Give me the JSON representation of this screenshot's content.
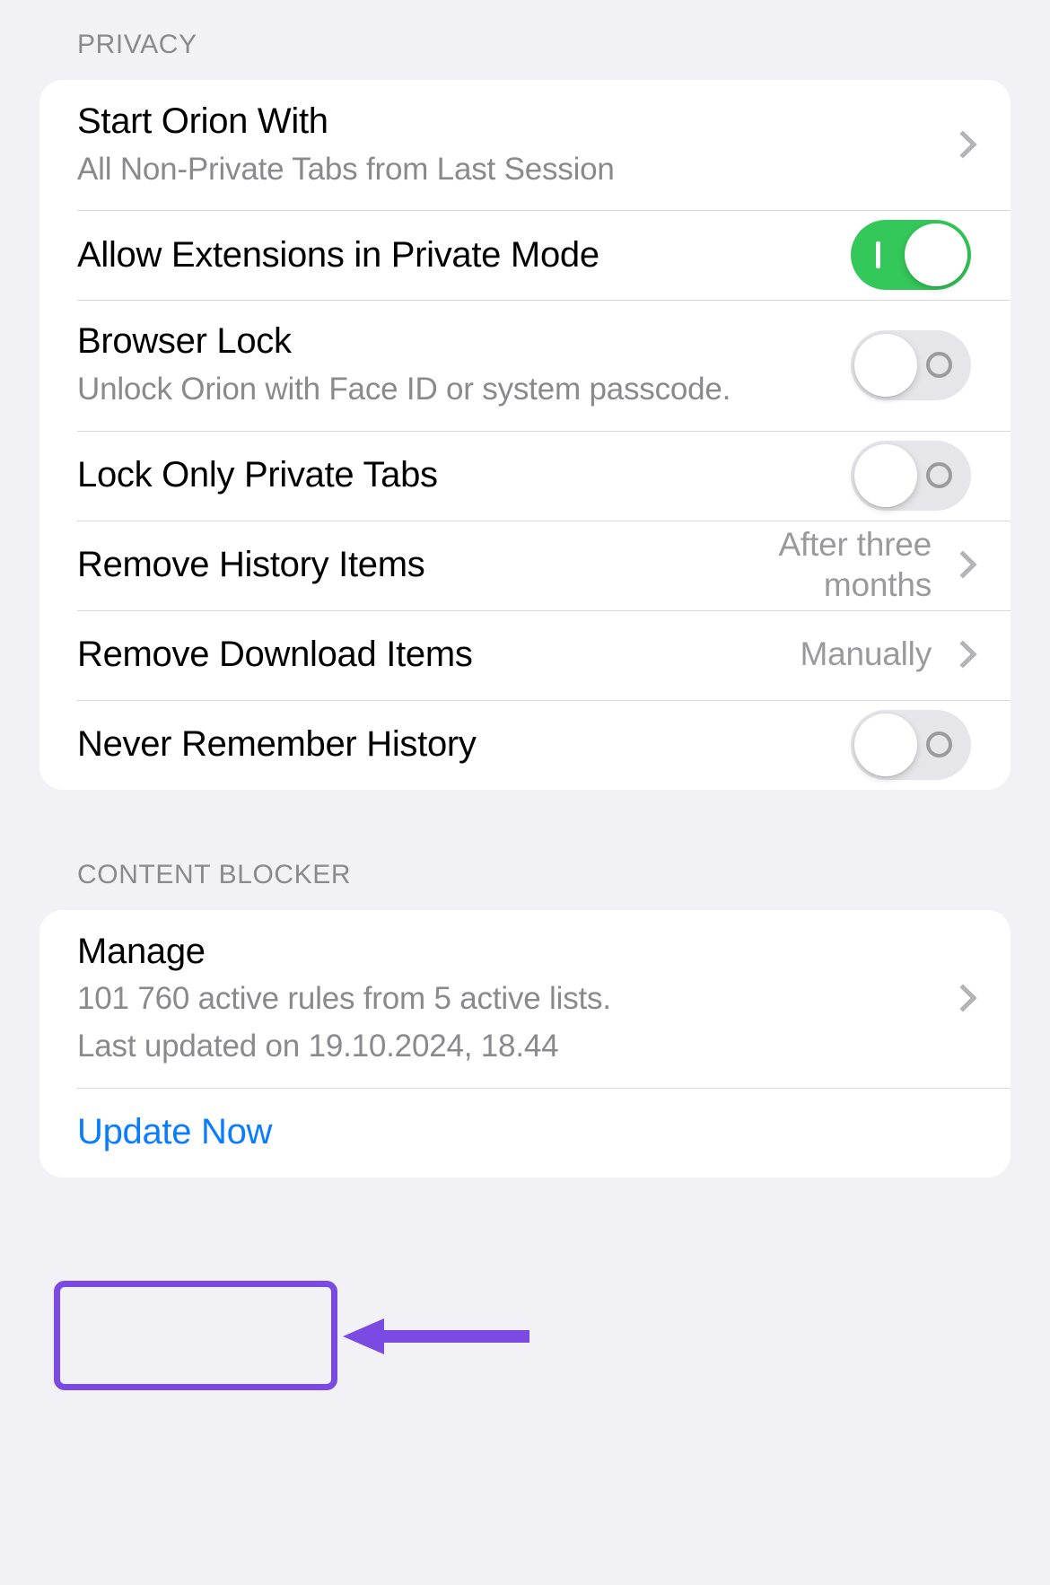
{
  "sections": [
    {
      "header": "PRIVACY",
      "rows": [
        {
          "name": "start-orion-with",
          "title": "Start Orion With",
          "subtitle": "All Non-Private Tabs from Last Session",
          "accessory": "chevron"
        },
        {
          "name": "allow-extensions-in-private-mode",
          "title": "Allow Extensions in Private Mode",
          "accessory": "toggle",
          "toggle_state": "on"
        },
        {
          "name": "browser-lock",
          "title": "Browser Lock",
          "subtitle": "Unlock Orion with Face ID or system passcode.",
          "accessory": "toggle",
          "toggle_state": "off"
        },
        {
          "name": "lock-only-private-tabs",
          "title": "Lock Only Private Tabs",
          "accessory": "toggle",
          "toggle_state": "off"
        },
        {
          "name": "remove-history-items",
          "title": "Remove History Items",
          "value": "After three months",
          "accessory": "chevron"
        },
        {
          "name": "remove-download-items",
          "title": "Remove Download Items",
          "value": "Manually",
          "accessory": "chevron"
        },
        {
          "name": "never-remember-history",
          "title": "Never Remember History",
          "accessory": "toggle",
          "toggle_state": "off"
        }
      ]
    },
    {
      "header": "CONTENT BLOCKER",
      "rows": [
        {
          "name": "manage",
          "title": "Manage",
          "subtitle": "101 760 active rules from 5 active lists.",
          "subtitle2": "Last updated on 19.10.2024, 18.44",
          "accessory": "chevron"
        },
        {
          "name": "update-now",
          "link": "Update Now",
          "accessory": "none"
        }
      ]
    }
  ],
  "colors": {
    "page_background": "#f2f1f6",
    "card_background": "#ffffff",
    "primary_text": "#000000",
    "secondary_text": "#8a8a8e",
    "link_blue": "#0a7cff",
    "toggle_on_green": "#34c759",
    "toggle_off_gray": "#e6e6ea",
    "chevron_gray": "#b3b3b8",
    "annotation_purple": "#7b4ae2"
  },
  "annotation": {
    "highlight_target": "update-now",
    "shape": "rectangle-outline",
    "pointer": "left-arrow"
  }
}
